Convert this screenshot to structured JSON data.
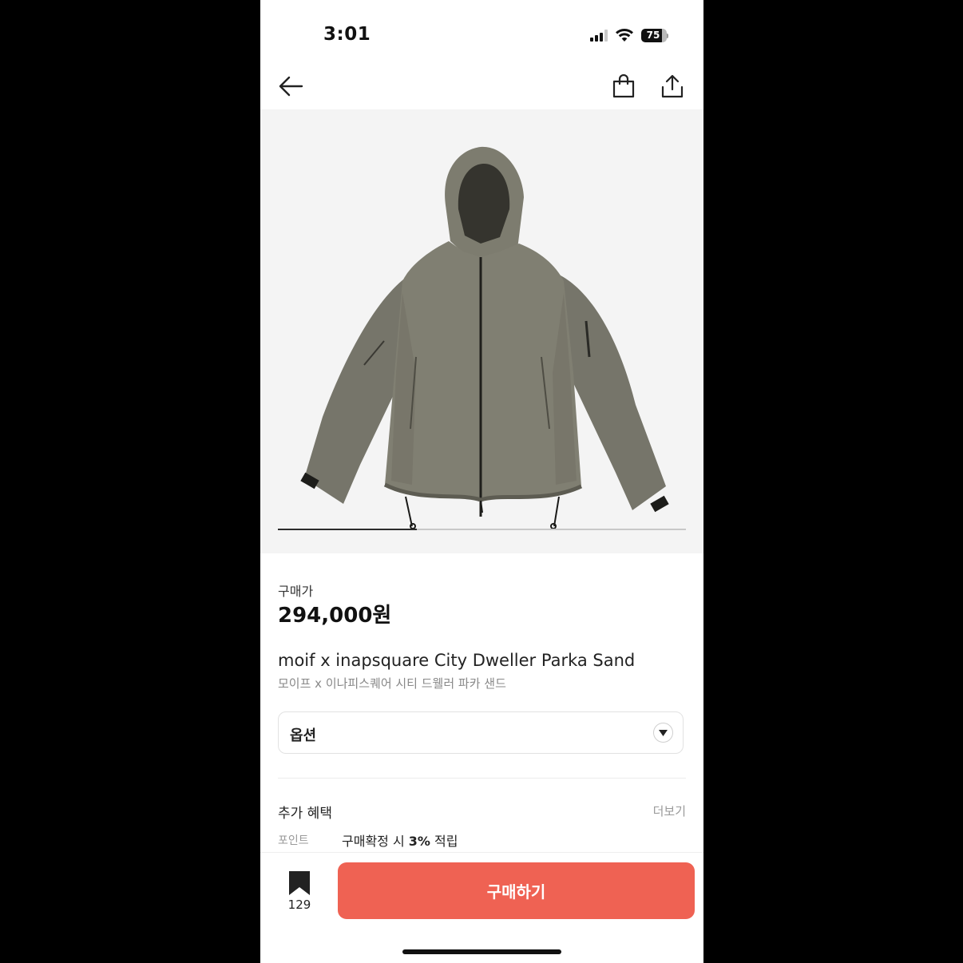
{
  "status_bar": {
    "time": "3:01",
    "battery": "75"
  },
  "product": {
    "price_label": "구매가",
    "price": "294,000원",
    "name_en": "moif x inapsquare City Dweller Parka Sand",
    "name_ko": "모이프 x 이나피스퀘어 시티 드웰러 파카 샌드",
    "image_progress": 0.34
  },
  "option": {
    "label": "옵션"
  },
  "benefits": {
    "title": "추가 혜택",
    "more": "더보기",
    "point_label": "포인트",
    "point_prefix": "구매확정 시 ",
    "point_rate": "3%",
    "point_suffix": " 적립"
  },
  "bottom_bar": {
    "bookmark_count": "129",
    "buy_label": "구매하기"
  },
  "colors": {
    "buy_button": "#ef6253",
    "gallery_bg": "#f4f4f4",
    "jacket": "#7b7a6c"
  }
}
